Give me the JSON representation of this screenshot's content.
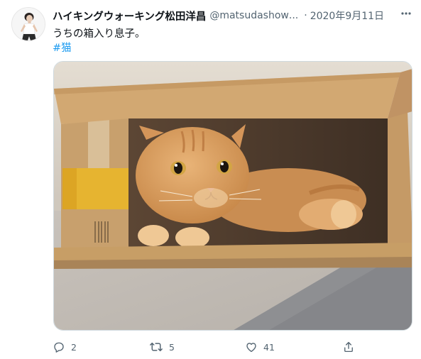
{
  "tweet": {
    "display_name": "ハイキングウォーキング松田洋昌",
    "handle": "@matsudashow",
    "handle_truncation": "...",
    "separator": "·",
    "date": "2020年9月11日",
    "text": "うちの箱入り息子。",
    "hashtag": "#猫"
  },
  "actions": {
    "reply_count": "2",
    "retweet_count": "5",
    "like_count": "41"
  },
  "icons": {
    "more": "more-horizontal-icon",
    "reply": "reply-icon",
    "retweet": "retweet-icon",
    "like": "heart-icon",
    "share": "share-icon"
  },
  "colors": {
    "link": "#1d9bf0",
    "secondary_text": "#536471",
    "primary_text": "#0f1419"
  }
}
